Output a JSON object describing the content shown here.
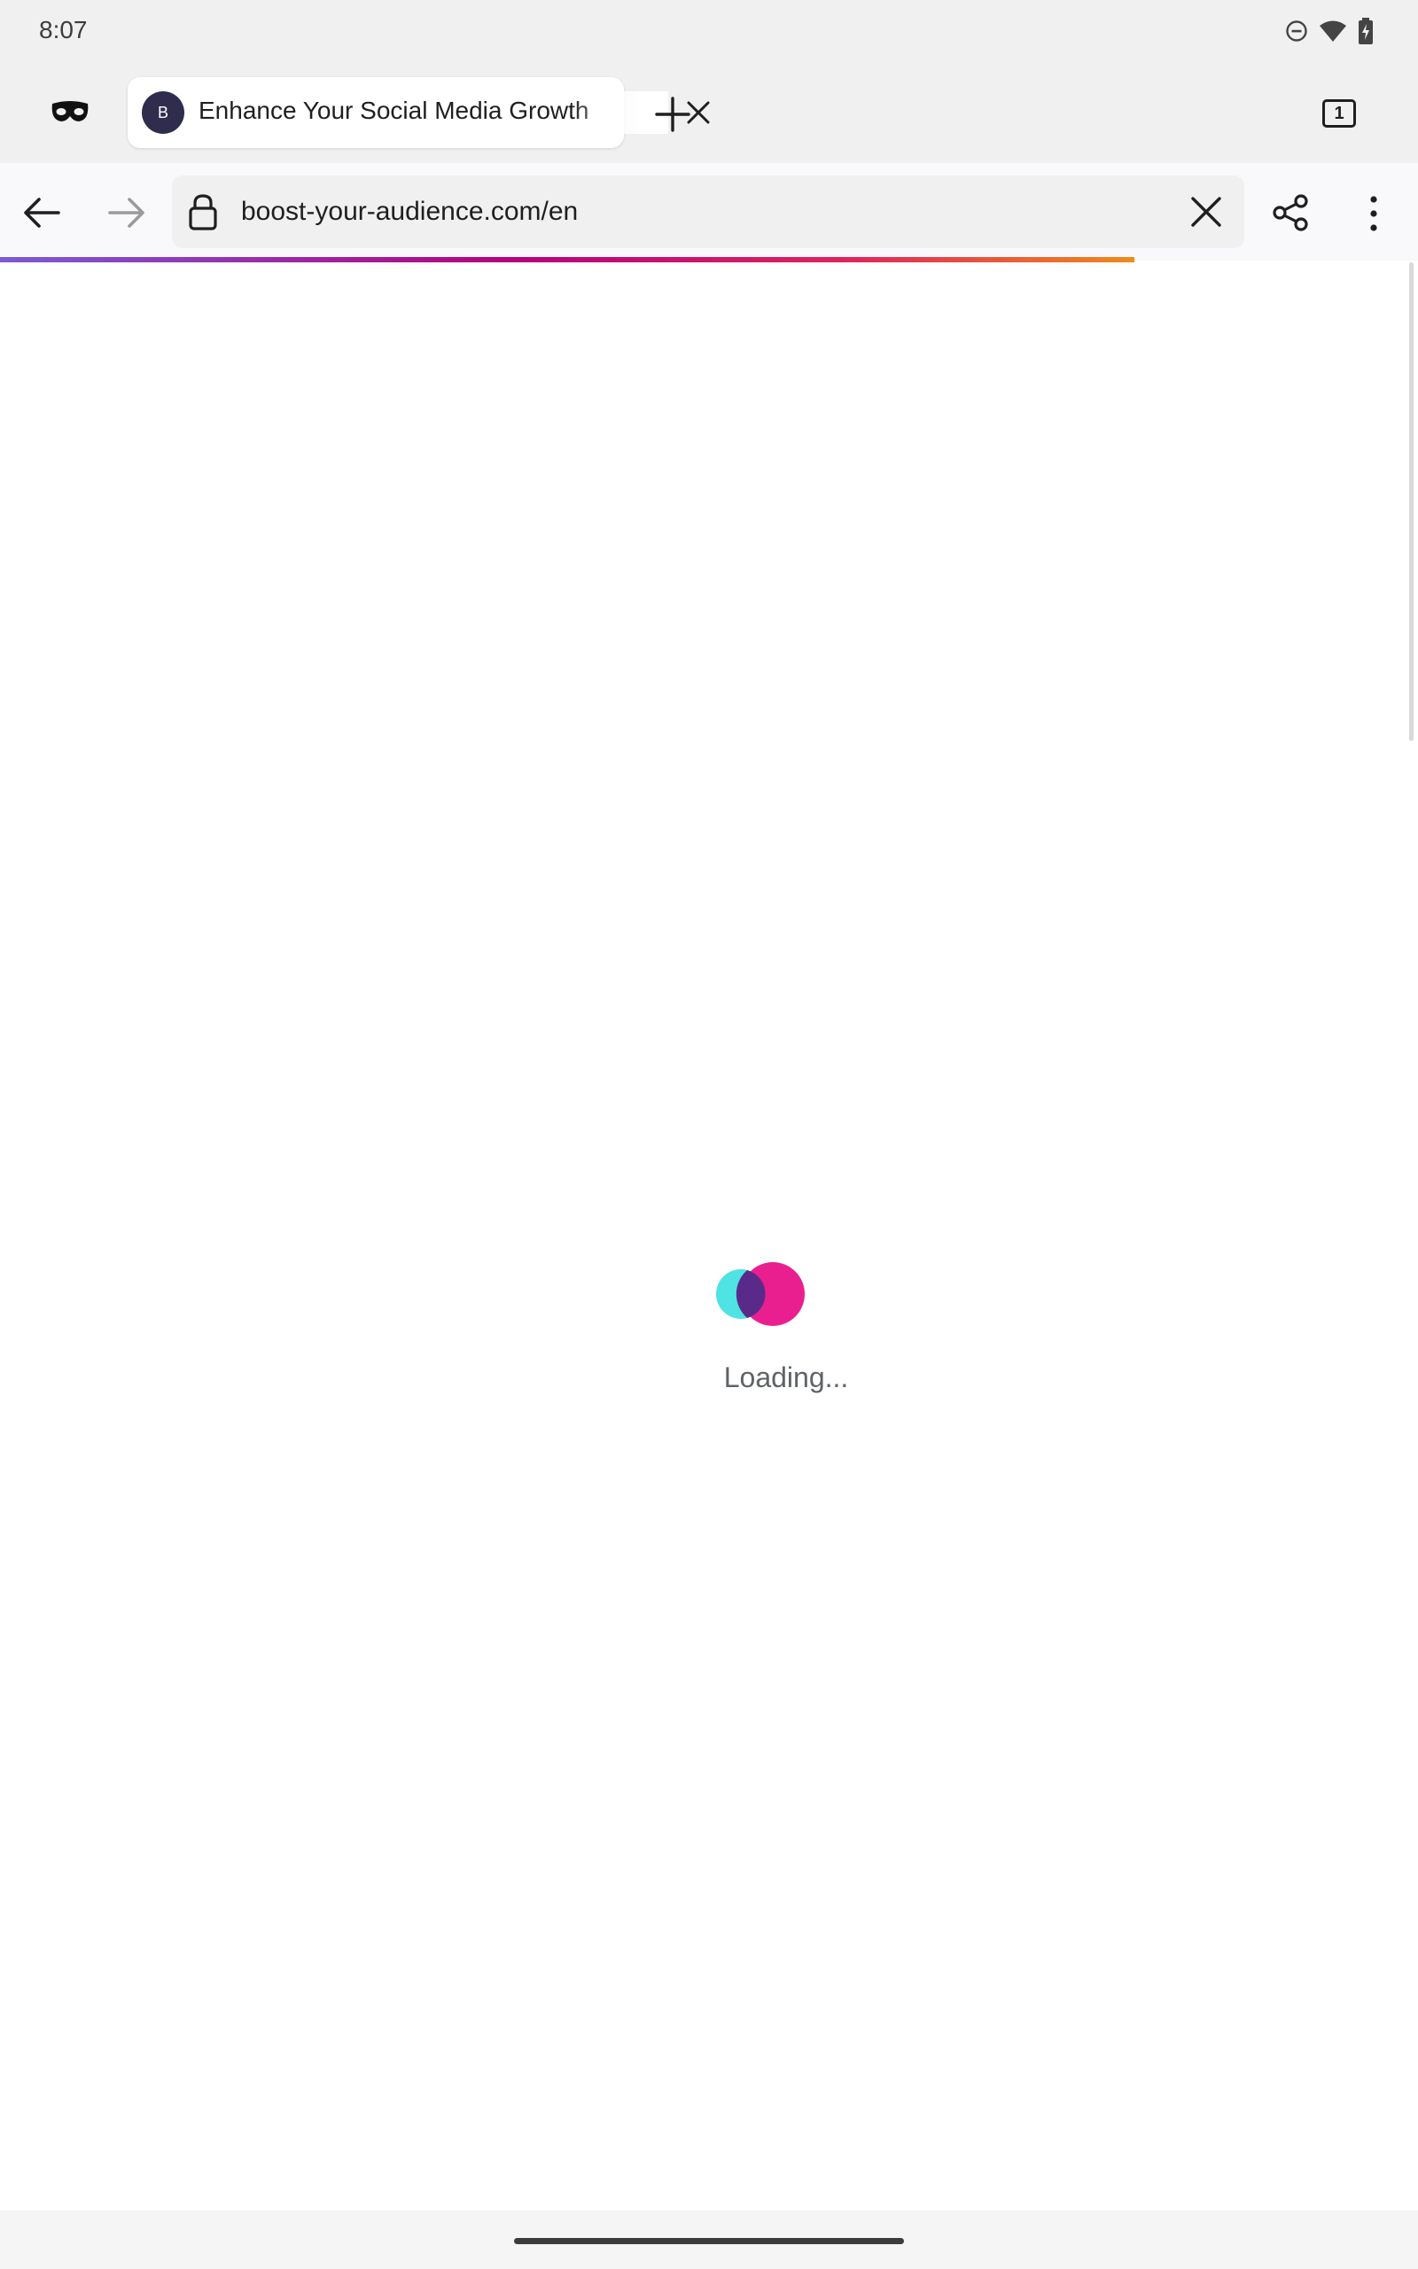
{
  "status_bar": {
    "time": "8:07",
    "icons": [
      "do-not-disturb-icon",
      "wifi-icon",
      "battery-charging-icon"
    ]
  },
  "tab_strip": {
    "private_mode_icon": "private-mask-icon",
    "active_tab": {
      "favicon_letter": "B",
      "title": "Enhance Your Social Media Growth"
    },
    "new_tab_icon": "plus-icon",
    "tab_count": "1"
  },
  "toolbar": {
    "url": "boost-your-audience.com/en",
    "icons": [
      "back-arrow-icon",
      "forward-arrow-icon",
      "lock-icon",
      "clear-icon",
      "share-icon",
      "more-vert-icon"
    ]
  },
  "page_load": {
    "progress_percent": 80,
    "progress_colors": [
      "#7b5bd6",
      "#b5007f",
      "#e0245c",
      "#f08a1c"
    ]
  },
  "content": {
    "loading_text": "Loading...",
    "loader_colors": {
      "left": "#4fe3e3",
      "right": "#ea1f8f",
      "overlap": "#5a2a8a"
    }
  }
}
